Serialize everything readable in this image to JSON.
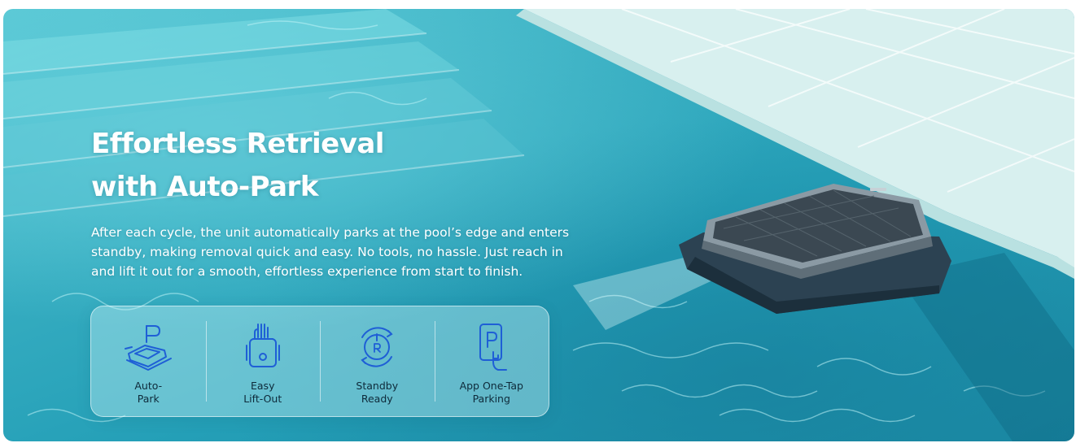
{
  "hero": {
    "headline_line1": "Effortless Retrieval",
    "headline_line2": "with Auto-Park",
    "body_line1": "After each cycle, the unit automatically parks at the pool’s edge and enters",
    "body_line2": "standby, making removal quick and easy. No tools, no hassle. Just reach in",
    "body_line3": "and lift it out for a smooth, effortless experience from start to finish."
  },
  "features": [
    {
      "icon": "auto-park-icon",
      "label_line1": "Auto-",
      "label_line2": "Park"
    },
    {
      "icon": "lift-out-icon",
      "label_line1": "Easy",
      "label_line2": "Lift-Out"
    },
    {
      "icon": "standby-power-icon",
      "label_line1": "Standby",
      "label_line2": "Ready"
    },
    {
      "icon": "app-parking-icon",
      "label_line1": "App One-Tap",
      "label_line2": "Parking"
    }
  ],
  "colors": {
    "water": "#35acc0",
    "deck": "#d6efef",
    "icon_blue": "#1f5fd6",
    "label_dark": "#0e2a3a",
    "headline": "#ffffff"
  }
}
